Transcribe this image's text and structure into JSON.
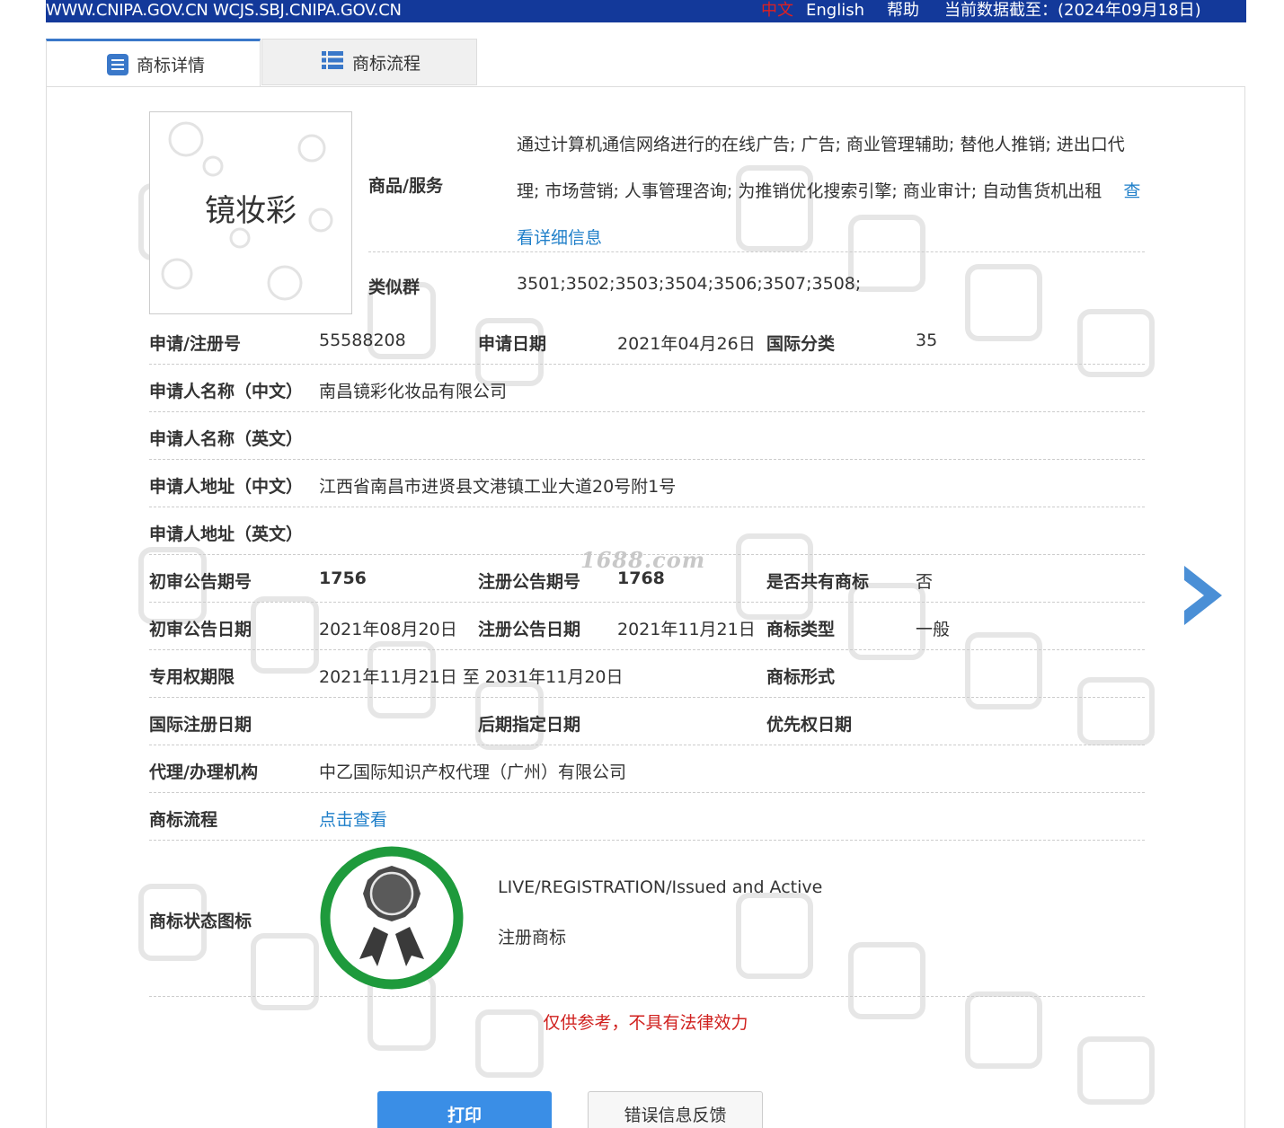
{
  "topbar": {
    "domains": "WWW.CNIPA.GOV.CN WCJS.SBJ.CNIPA.GOV.CN",
    "lang_zh": "中文",
    "lang_en": "English",
    "help": "帮助",
    "data_cutoff": "当前数据截至：(2024年09月18日)"
  },
  "tabs": [
    {
      "label": "商标详情",
      "icon": "list-document-icon"
    },
    {
      "label": "商标流程",
      "icon": "list-bullet-icon"
    }
  ],
  "trademark": {
    "image_text": "镜妆彩",
    "goods_label": "商品/服务",
    "goods_text": "通过计算机通信网络进行的在线广告; 广告; 商业管理辅助; 替他人推销; 进出口代理; 市场营销; 人事管理咨询; 为推销优化搜索引擎; 商业审计; 自动售货机出租",
    "goods_more_link": "查看详细信息",
    "similar_label": "类似群",
    "similar_value": "3501;3502;3503;3504;3506;3507;3508;"
  },
  "fields": {
    "reg_no_label": "申请/注册号",
    "reg_no": "55588208",
    "apply_date_label": "申请日期",
    "apply_date": "2021年04月26日",
    "intl_class_label": "国际分类",
    "intl_class": "35",
    "applicant_cn_label": "申请人名称（中文）",
    "applicant_cn": "南昌镜彩化妆品有限公司",
    "applicant_en_label": "申请人名称（英文）",
    "applicant_en": "",
    "address_cn_label": "申请人地址（中文）",
    "address_cn": "江西省南昌市进贤县文港镇工业大道20号附1号",
    "address_en_label": "申请人地址（英文）",
    "address_en": "",
    "prelim_no_label": "初审公告期号",
    "prelim_no": "1756",
    "reg_pub_no_label": "注册公告期号",
    "reg_pub_no": "1768",
    "shared_label": "是否共有商标",
    "shared": "否",
    "prelim_date_label": "初审公告日期",
    "prelim_date": "2021年08月20日",
    "reg_pub_date_label": "注册公告日期",
    "reg_pub_date": "2021年11月21日",
    "tm_type_label": "商标类型",
    "tm_type": "一般",
    "term_label": "专用权期限",
    "term": "2021年11月21日 至 2031年11月20日",
    "tm_form_label": "商标形式",
    "tm_form": "",
    "intl_reg_date_label": "国际注册日期",
    "intl_reg_date": "",
    "later_designation_label": "后期指定日期",
    "later_designation": "",
    "priority_date_label": "优先权日期",
    "priority_date": "",
    "agent_label": "代理/办理机构",
    "agent": "中乙国际知识产权代理（广州）有限公司",
    "process_label": "商标流程",
    "process_link": "点击查看"
  },
  "status": {
    "label": "商标状态图标",
    "icon": "registered-award-icon",
    "status_en": "LIVE/REGISTRATION/Issued and Active",
    "status_cn": "注册商标"
  },
  "disclaimer": "仅供参考，不具有法律效力",
  "buttons": {
    "print": "打印",
    "feedback": "错误信息反馈"
  },
  "watermark": "1688.com",
  "colors": {
    "topbar": "#13399a",
    "accent": "#3a78c9",
    "link": "#1f7fc9",
    "disclaimer": "#d0201e",
    "badge_ring": "#1e9a3c"
  }
}
